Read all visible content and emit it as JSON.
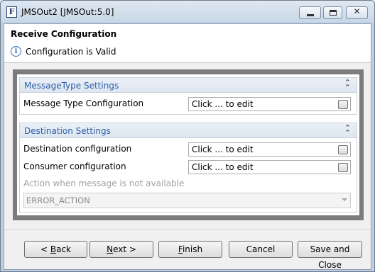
{
  "window": {
    "title": "JMSOut2 [JMSOut:5.0]",
    "app_icon_letter": "F"
  },
  "header": {
    "title": "Receive Configuration",
    "status": "Configuration is Valid",
    "info_glyph": "i"
  },
  "sections": {
    "message_type": {
      "title": "MessageType Settings",
      "rows": [
        {
          "label": "Message Type Configuration",
          "value": "Click ... to edit"
        }
      ]
    },
    "destination": {
      "title": "Destination Settings",
      "rows": [
        {
          "label": "Destination configuration",
          "value": "Click ... to edit"
        },
        {
          "label": "Consumer configuration",
          "value": "Click ... to edit"
        }
      ],
      "action_label": "Action when message is not available",
      "action_value": "ERROR_ACTION"
    }
  },
  "buttons": {
    "back": {
      "prefix": "< ",
      "mnemonic": "B",
      "rest": "ack"
    },
    "next": {
      "mnemonic": "N",
      "rest": "ext >"
    },
    "finish": {
      "mnemonic": "F",
      "rest": "inish"
    },
    "cancel": "Cancel",
    "save_close": "Save and Close"
  },
  "icons": {
    "collapse": "double-chevron-up-icon",
    "info": "info-icon",
    "dropdown": "chevron-down-icon"
  }
}
